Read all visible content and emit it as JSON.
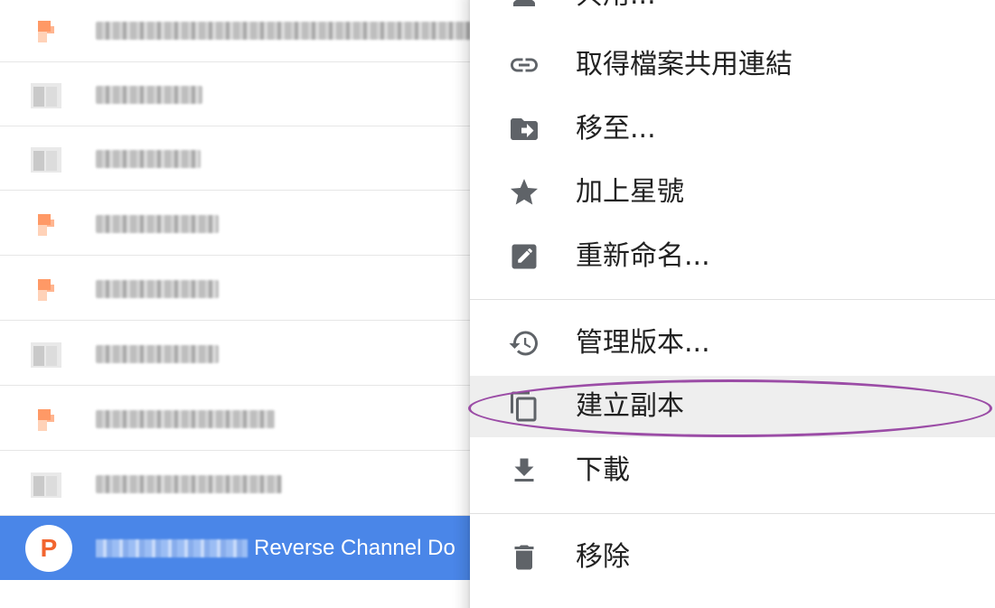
{
  "file_list": {
    "rows": [
      {
        "icon": "slides-file-icon"
      },
      {
        "icon": "generic-file-icon"
      },
      {
        "icon": "generic-file-icon"
      },
      {
        "icon": "slides-file-icon"
      },
      {
        "icon": "slides-file-icon"
      },
      {
        "icon": "generic-file-icon"
      },
      {
        "icon": "slides-file-icon"
      },
      {
        "icon": "generic-file-icon"
      }
    ],
    "selected": {
      "avatar_letter": "P",
      "name_visible": "Reverse Channel Do"
    }
  },
  "context_menu": {
    "items": [
      {
        "id": "share",
        "icon": "person-icon",
        "label": "共用..."
      },
      {
        "id": "get-link",
        "icon": "link-icon",
        "label": "取得檔案共用連結"
      },
      {
        "id": "move-to",
        "icon": "move-folder-icon",
        "label": "移至..."
      },
      {
        "id": "star",
        "icon": "star-icon",
        "label": "加上星號"
      },
      {
        "id": "rename",
        "icon": "edit-icon",
        "label": "重新命名..."
      },
      {
        "id": "manage-versions",
        "icon": "history-icon",
        "label": "管理版本..."
      },
      {
        "id": "make-copy",
        "icon": "copy-icon",
        "label": "建立副本",
        "hovered": true,
        "annotated": true
      },
      {
        "id": "download",
        "icon": "download-icon",
        "label": "下載"
      },
      {
        "id": "remove",
        "icon": "trash-icon",
        "label": "移除"
      }
    ]
  },
  "colors": {
    "selected_row": "#4a86e8",
    "slides_orange": "#f2652f",
    "annotation": "#9b4ca6",
    "hover": "#eeeeee"
  }
}
